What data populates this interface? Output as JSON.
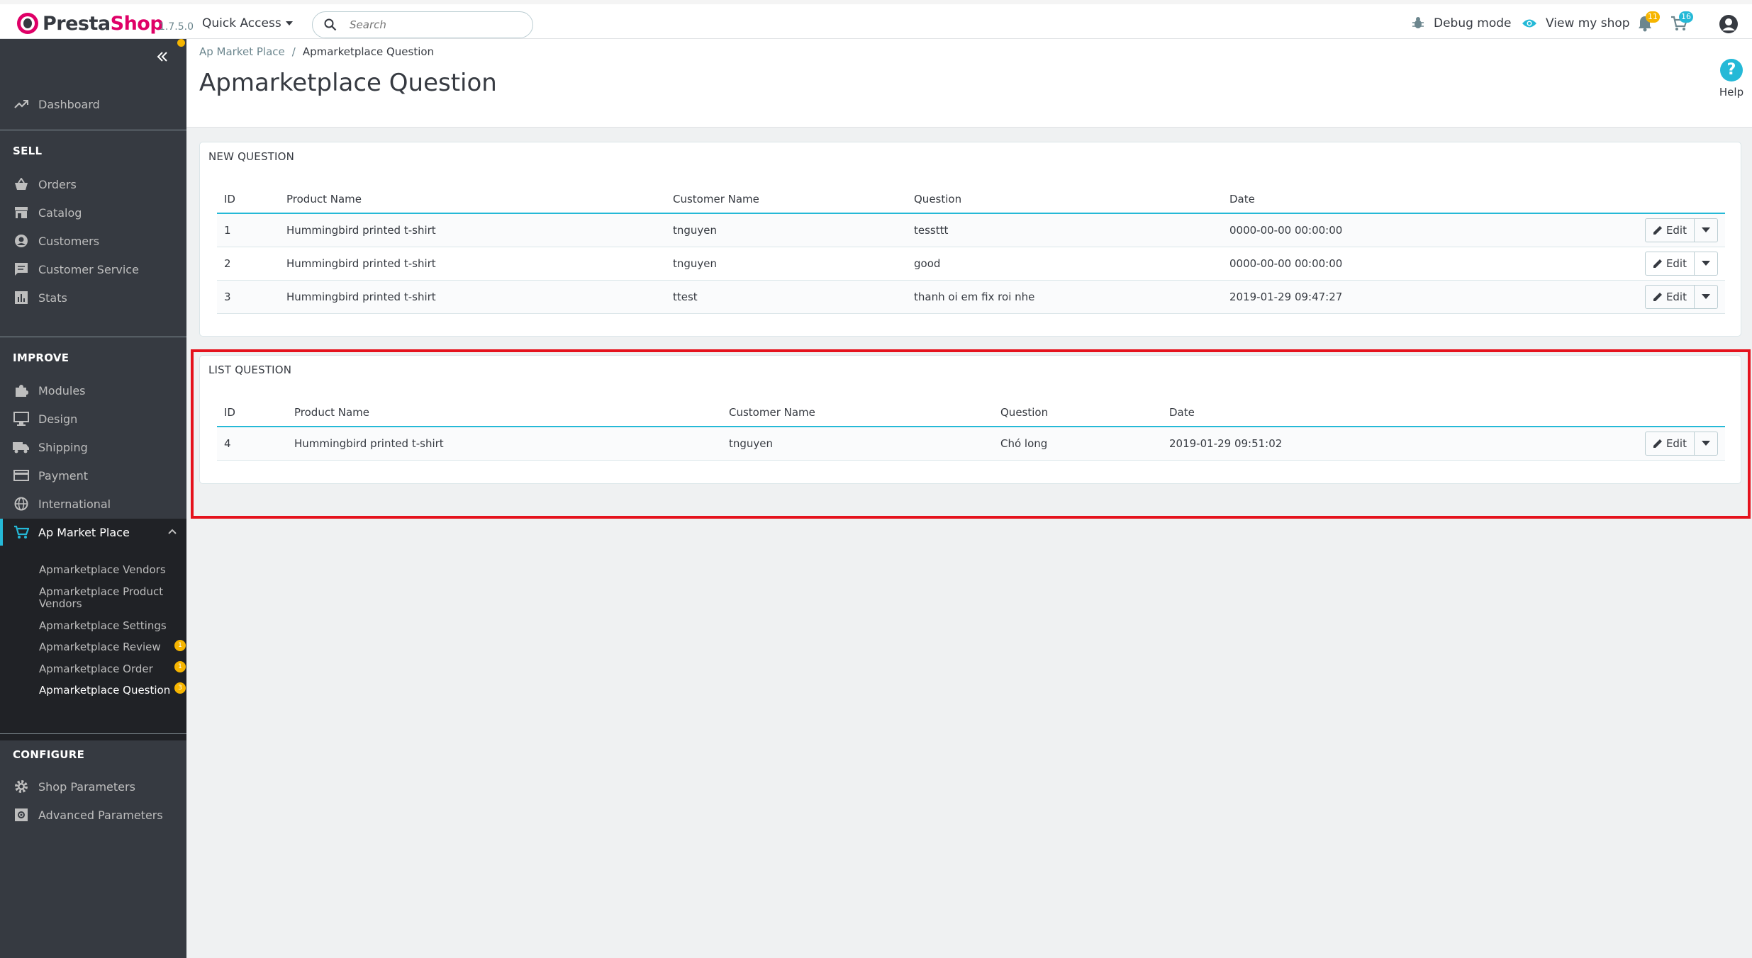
{
  "header": {
    "brand_presta": "Presta",
    "brand_shop": "Shop",
    "version": "1.7.5.0",
    "quick_access": "Quick Access",
    "search_placeholder": "Search",
    "debug_mode": "Debug mode",
    "view_shop": "View my shop",
    "notif_orders_count": "11",
    "notif_cart_count": "16"
  },
  "sidebar": {
    "dashboard": "Dashboard",
    "sell_title": "SELL",
    "sell_items": [
      "Orders",
      "Catalog",
      "Customers",
      "Customer Service",
      "Stats"
    ],
    "improve_title": "IMPROVE",
    "improve_items": [
      "Modules",
      "Design",
      "Shipping",
      "Payment",
      "International",
      "Ap Market Place"
    ],
    "submenu": [
      "Apmarketplace Vendors",
      "Apmarketplace Product Vendors",
      "Apmarketplace Settings",
      "Apmarketplace Review",
      "Apmarketplace Order",
      "Apmarketplace Question"
    ],
    "submenu_badges": [
      "1",
      "1",
      "3"
    ],
    "configure_title": "CONFIGURE",
    "configure_items": [
      "Shop Parameters",
      "Advanced Parameters"
    ]
  },
  "page": {
    "breadcrumb_parent": "Ap Market Place",
    "breadcrumb_sep": "/",
    "breadcrumb_current": "Apmarketplace Question",
    "title": "Apmarketplace Question",
    "help": "Help",
    "help_icon_glyph": "?"
  },
  "new_question": {
    "title": "NEW QUESTION",
    "columns": [
      "ID",
      "Product Name",
      "Customer Name",
      "Question",
      "Date"
    ],
    "rows": [
      {
        "id": "1",
        "product": "Hummingbird printed t-shirt",
        "customer": "tnguyen",
        "question": "tessttt",
        "date": "0000-00-00 00:00:00"
      },
      {
        "id": "2",
        "product": "Hummingbird printed t-shirt",
        "customer": "tnguyen",
        "question": "good",
        "date": "0000-00-00 00:00:00"
      },
      {
        "id": "3",
        "product": "Hummingbird printed t-shirt",
        "customer": "ttest",
        "question": "thanh oi em fix roi nhe",
        "date": "2019-01-29 09:47:27"
      }
    ],
    "edit_label": "Edit"
  },
  "list_question": {
    "title": "LIST QUESTION",
    "columns": [
      "ID",
      "Product Name",
      "Customer Name",
      "Question",
      "Date"
    ],
    "rows": [
      {
        "id": "4",
        "product": "Hummingbird printed t-shirt",
        "customer": "tnguyen",
        "question": "Chó long",
        "date": "2019-01-29 09:51:02"
      }
    ],
    "edit_label": "Edit"
  },
  "colors": {
    "accent": "#25b9d7",
    "brand": "#df0067",
    "sidebar_bg": "#363a41",
    "badge": "#f6b500",
    "highlight": "#e5121d"
  }
}
